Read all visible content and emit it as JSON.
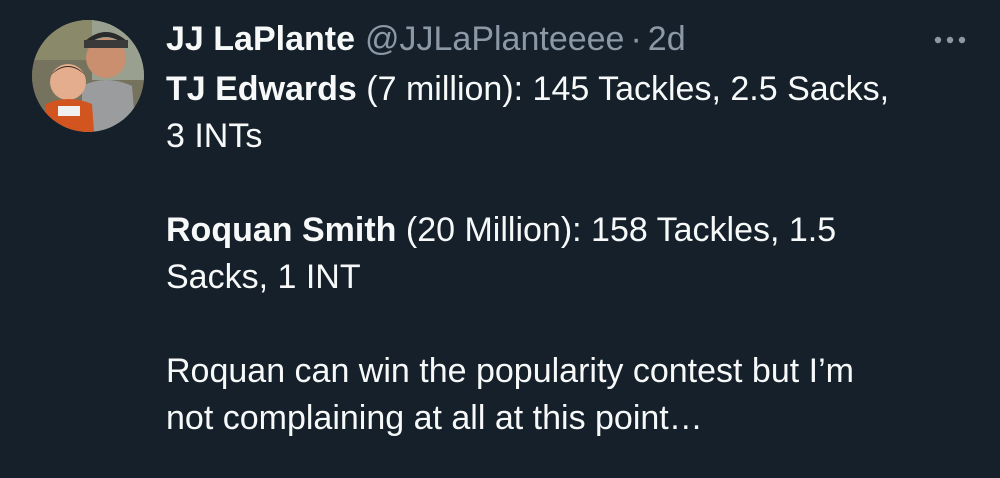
{
  "author": {
    "display_name": "JJ LaPlante",
    "handle": "@JJLaPlanteeee",
    "separator": "·",
    "time": "2d"
  },
  "more_button": {
    "icon": "more-horizontal-icon"
  },
  "colors": {
    "background": "#15202b",
    "text_primary": "#f7f9f9",
    "text_secondary": "#8b98a5"
  },
  "tweet": {
    "line1_name": "TJ Edwards",
    "line1_rest": " (7 million): 145 Tackles, 2.5 Sacks,",
    "line1_cont": "3 INTs",
    "line2_name": "Roquan Smith",
    "line2_rest": " (20 Million): 158 Tackles, 1.5",
    "line2_cont": "Sacks, 1 INT",
    "line3_a": "Roquan can win the popularity contest but I’m",
    "line3_b": "not complaining at all at this point…"
  }
}
